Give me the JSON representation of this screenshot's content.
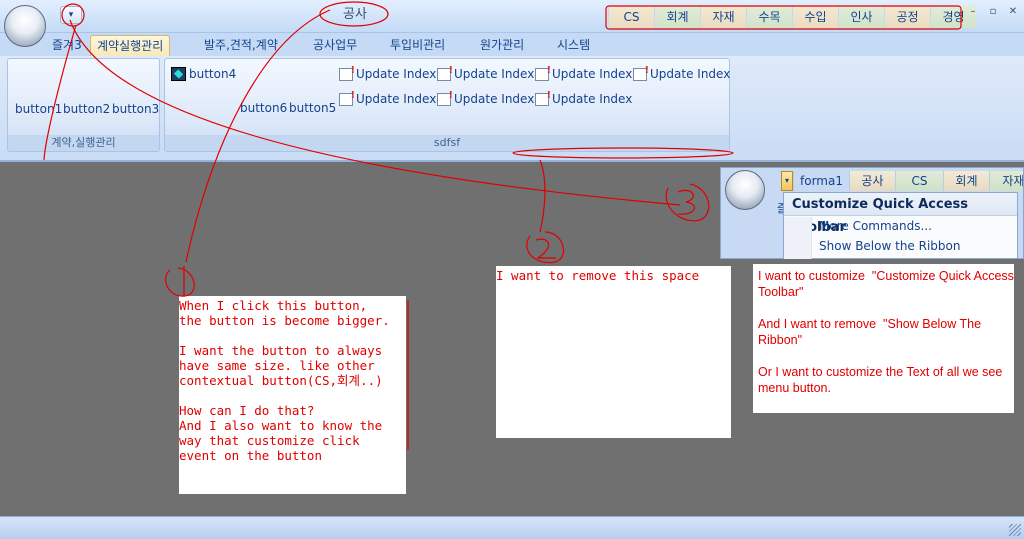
{
  "window": {
    "title": "공사",
    "qat_label": "▾",
    "controls": [
      "–",
      "▫",
      "✕"
    ]
  },
  "context_tabs": [
    "CS",
    "회계",
    "자재",
    "수목",
    "수입",
    "인사",
    "공정",
    "경영"
  ],
  "tabs": [
    "즐겨3",
    "계약실행관리",
    "발주,견적,계약",
    "공사업무",
    "투입비관리",
    "원가관리",
    "시스템"
  ],
  "ribbon": {
    "group1": {
      "label": "계약,실행관리",
      "buttons": [
        "button1",
        "button2",
        "button3"
      ]
    },
    "group2": {
      "label": "sdfsf",
      "button4": "button4",
      "button6": "button6",
      "button5": "button5",
      "update_row1": [
        "Update Index",
        "Update Index",
        "Update Index",
        "Update Index"
      ],
      "update_row2": [
        "Update Index",
        "Update Index",
        "Update Index"
      ]
    }
  },
  "inset": {
    "qat_label": "▾",
    "cells": [
      "forma1",
      "공사",
      "CS",
      "회계",
      "자재"
    ],
    "partial_tab": "즐"
  },
  "menu": {
    "header": "Customize Quick Access Toolbar",
    "items": [
      "More Commands...",
      "Show Below the Ribbon"
    ]
  },
  "notes": {
    "n1": "When I click this button,\nthe button is become bigger.\n\nI want the button to always\nhave same size. like other\ncontextual button(CS,회계..)\n\nHow can I do that?\nAnd I also want to know the\nway that customize click\nevent on the button",
    "n2": "I want to remove this space",
    "n3": "I want to customize  \"Customize Quick Access Toolbar\"\n\nAnd I want to remove  \"Show Below The Ribbon\"\n\nOr I want to customize the Text of all we see menu button."
  },
  "colors": {
    "annotation": "#e00000",
    "ribbon_bg": "#c9dcf5",
    "workspace": "#707070"
  }
}
